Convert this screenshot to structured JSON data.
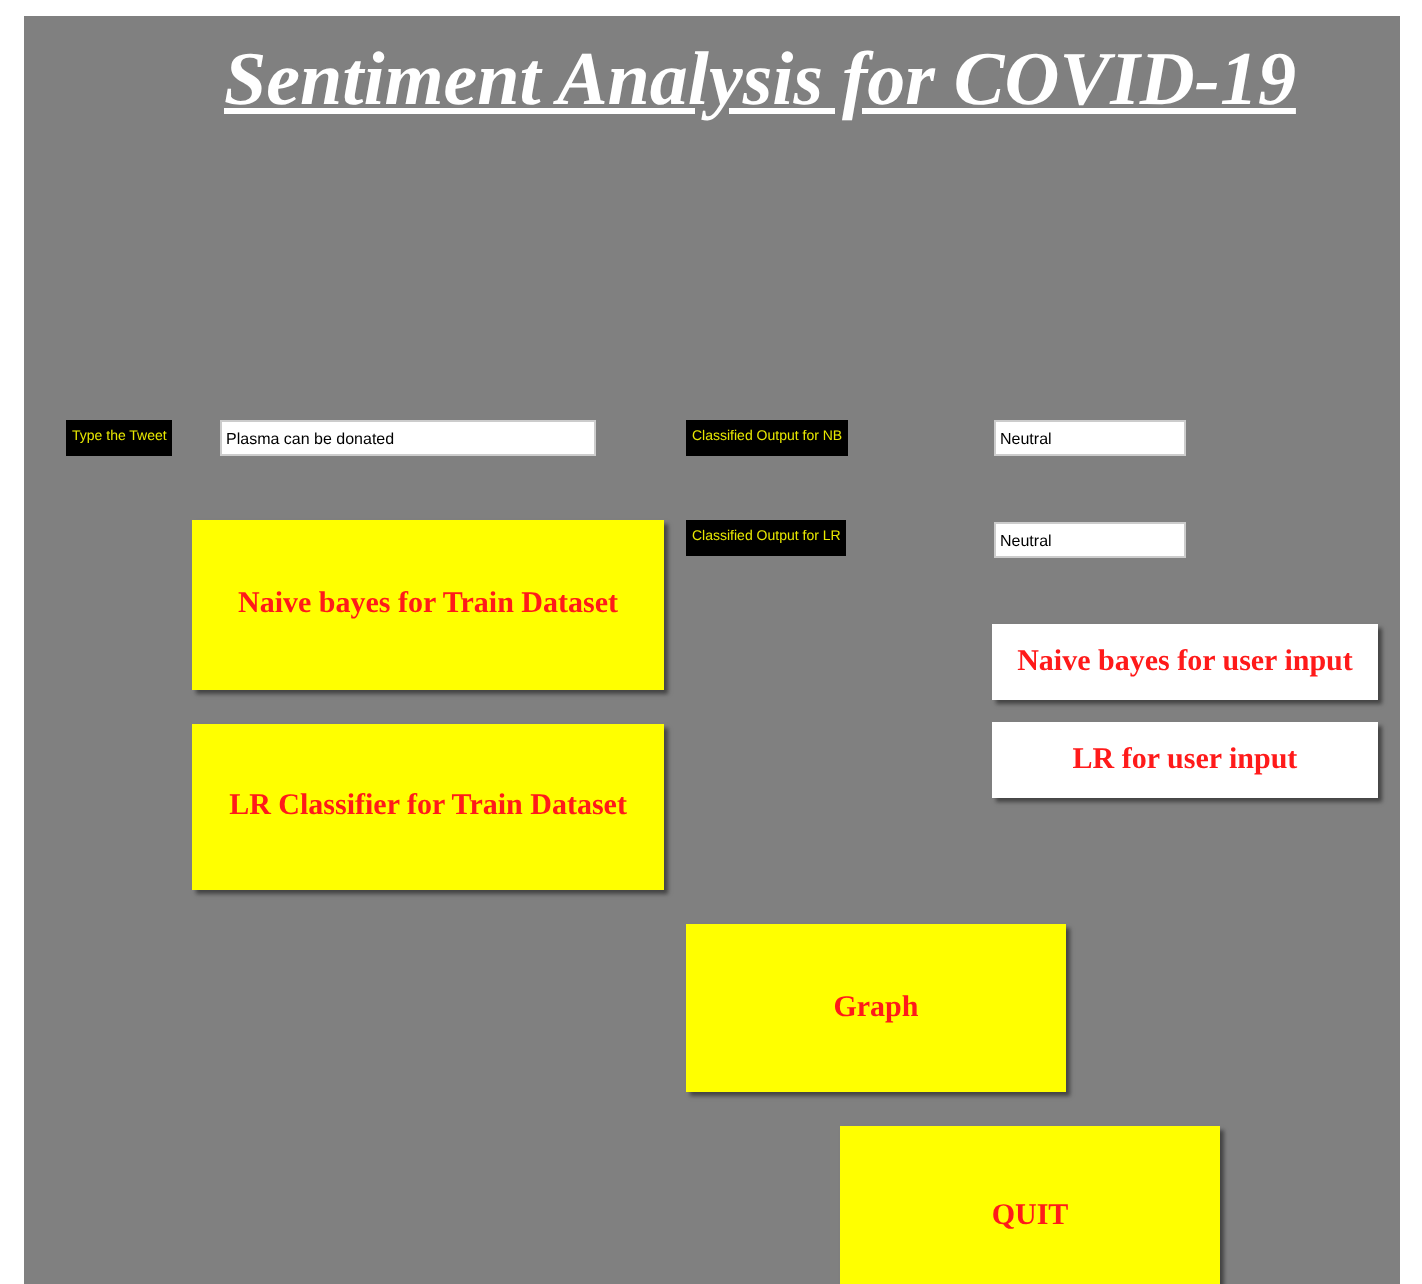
{
  "title": "Sentiment Analysis for COVID-19",
  "fields": [
    {
      "label": "Type the Tweet",
      "value": "Plasma can be donated"
    },
    {
      "label": "Classified Output for NB",
      "value": "Neutral"
    },
    {
      "label": "Classified Output for LR",
      "value": "Neutral"
    }
  ],
  "buttons": [
    {
      "label": "Naive bayes for Train Dataset",
      "kind": "yellow"
    },
    {
      "label": "LR Classifier for Train Dataset",
      "kind": "yellow"
    },
    {
      "label": "Naive bayes for user input",
      "kind": "white"
    },
    {
      "label": "LR for user input",
      "kind": "white"
    },
    {
      "label": "Graph",
      "kind": "yellow"
    },
    {
      "label": "QUIT",
      "kind": "yellow"
    }
  ]
}
